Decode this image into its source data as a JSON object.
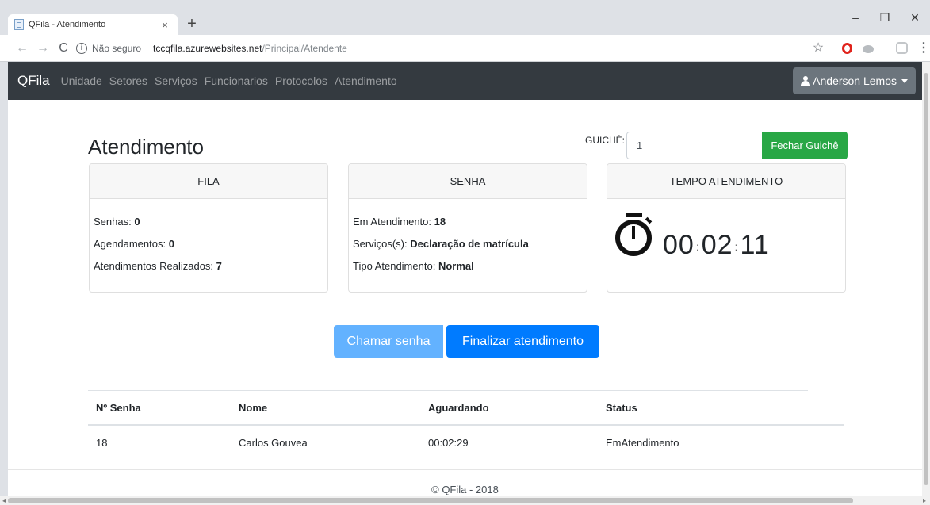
{
  "browser": {
    "tab_title": "QFila - Atendimento",
    "tab_close": "×",
    "new_tab": "+",
    "win_minimize": "–",
    "win_restore": "❐",
    "win_close": "✕",
    "nav_back": "←",
    "nav_forward": "→",
    "nav_reload": "C",
    "security_icon": "i",
    "security_text": "Não seguro",
    "url_host": "tccqfila.azurewebsites.net",
    "url_path": "/Principal/Atendente",
    "bookmark_star": "☆",
    "menu": "⋮"
  },
  "navbar": {
    "brand": "QFila",
    "links": [
      "Unidade",
      "Setores",
      "Serviços",
      "Funcionarios",
      "Protocolos",
      "Atendimento"
    ],
    "user": "Anderson Lemos"
  },
  "page": {
    "title": "Atendimento",
    "guiche_label": "GUICHÊ:",
    "guiche_value": "1",
    "fechar_button": "Fechar Guichê"
  },
  "cards": {
    "fila": {
      "header": "FILA",
      "senhas_label": "Senhas:",
      "senhas_value": "0",
      "agendamentos_label": "Agendamentos:",
      "agendamentos_value": "0",
      "realizados_label": "Atendimentos Realizados:",
      "realizados_value": "7"
    },
    "senha": {
      "header": "SENHA",
      "em_atendimento_label": "Em Atendimento:",
      "em_atendimento_value": "18",
      "servicos_label": "Serviços(s):",
      "servicos_value": "Declaração de matrícula",
      "tipo_label": "Tipo Atendimento:",
      "tipo_value": "Normal"
    },
    "tempo": {
      "header": "TEMPO ATENDIMENTO",
      "hours": "00",
      "minutes": "02",
      "seconds": "11",
      "colon": ":"
    }
  },
  "actions": {
    "chamar": "Chamar senha",
    "finalizar": "Finalizar atendimento"
  },
  "table": {
    "headers": [
      "Nº Senha",
      "Nome",
      "Aguardando",
      "Status"
    ],
    "rows": [
      [
        "18",
        "Carlos Gouvea",
        "00:02:29",
        "EmAtendimento"
      ]
    ]
  },
  "footer": "© QFila - 2018",
  "scrollbar": {
    "left_arrow": "◂",
    "right_arrow": "▸"
  }
}
